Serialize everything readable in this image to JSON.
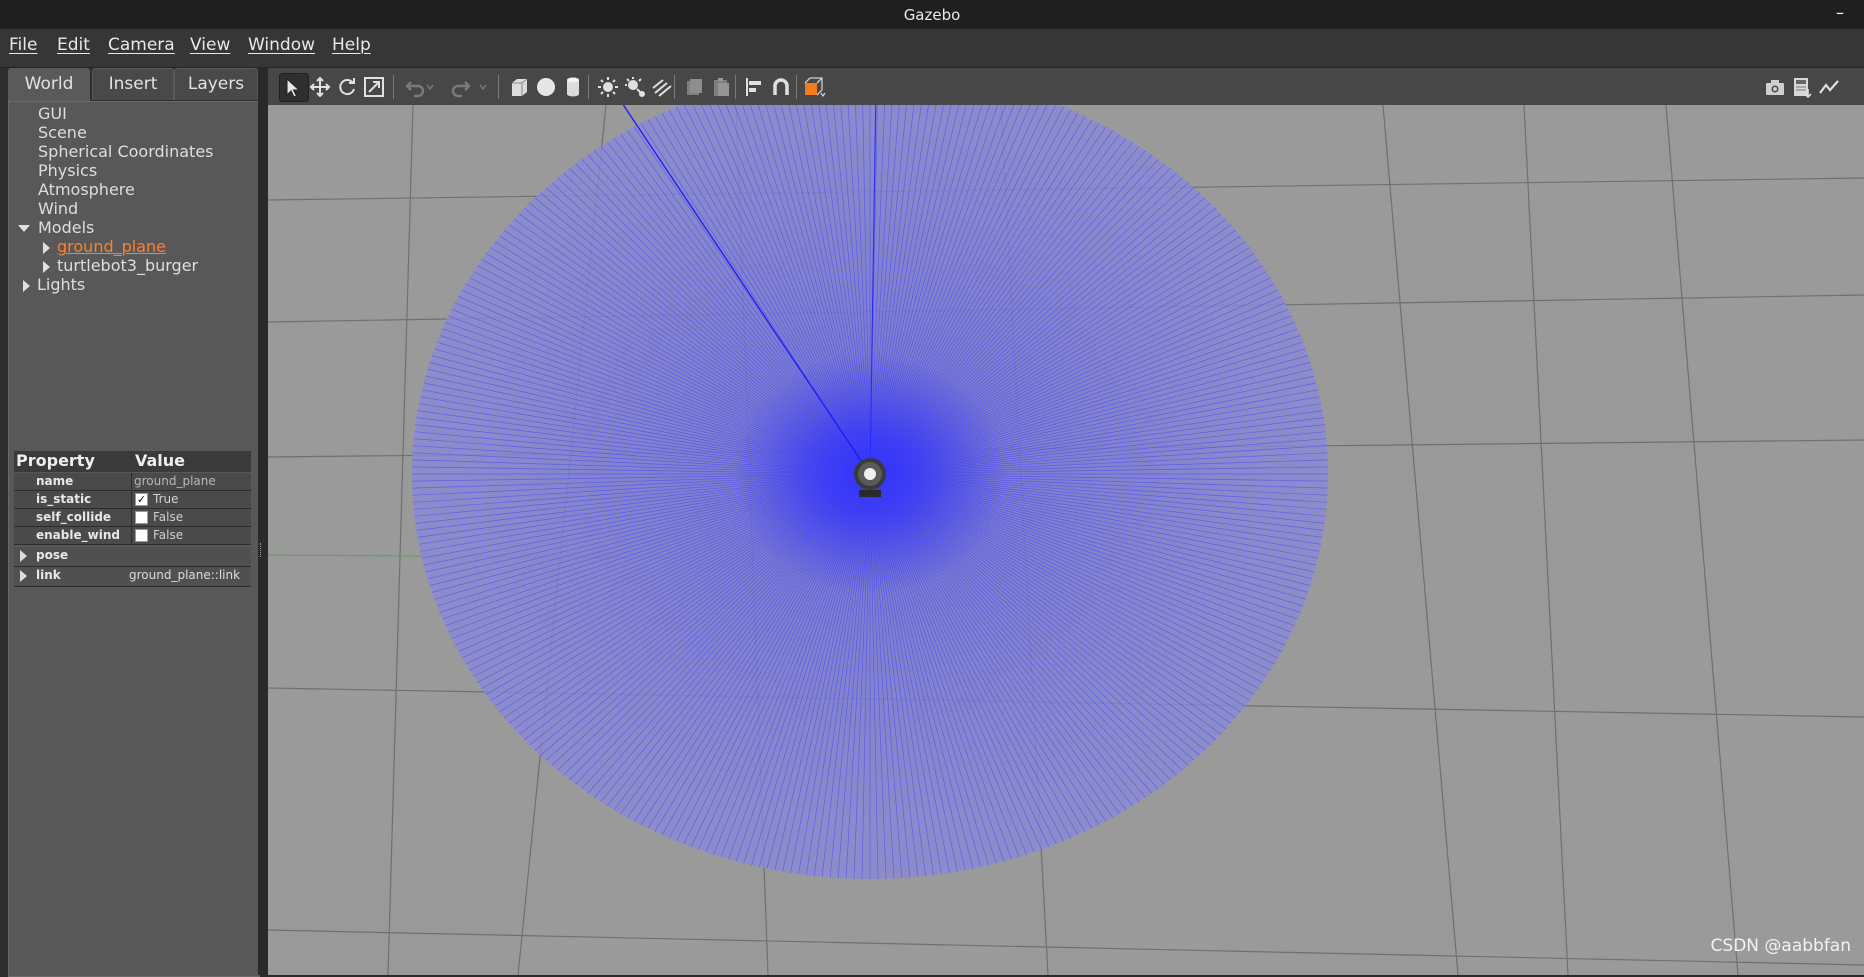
{
  "window": {
    "title": "Gazebo",
    "minimize_symbol": "–"
  },
  "menu": [
    "File",
    "Edit",
    "Camera",
    "View",
    "Window",
    "Help"
  ],
  "tabs": [
    "World",
    "Insert",
    "Layers"
  ],
  "tree": {
    "items": [
      "GUI",
      "Scene",
      "Spherical Coordinates",
      "Physics",
      "Atmosphere",
      "Wind"
    ],
    "models_label": "Models",
    "models": [
      "ground_plane",
      "turtlebot3_burger"
    ],
    "lights_label": "Lights"
  },
  "properties": {
    "header_property": "Property",
    "header_value": "Value",
    "name_key": "name",
    "name_value": "ground_plane",
    "is_static_key": "is_static",
    "is_static_value": "True",
    "is_static_checked": true,
    "self_collide_key": "self_collide",
    "self_collide_value": "False",
    "self_collide_checked": false,
    "enable_wind_key": "enable_wind",
    "enable_wind_value": "False",
    "enable_wind_checked": false,
    "pose_key": "pose",
    "link_key": "link",
    "link_value": "ground_plane::link"
  },
  "toolbar": {
    "selected_tool": "select",
    "icons": [
      "select-arrow-icon",
      "translate-icon",
      "rotate-icon",
      "scale-icon",
      "undo-icon",
      "undo-dropdown-icon",
      "redo-icon",
      "redo-dropdown-icon",
      "box-icon",
      "sphere-icon",
      "cylinder-icon",
      "point-light-icon",
      "spot-light-icon",
      "directional-light-icon",
      "copy-icon",
      "paste-icon",
      "align-icon",
      "snap-icon",
      "view-angle-icon",
      "screenshot-icon",
      "log-icon",
      "plot-icon"
    ]
  },
  "viewport": {
    "lidar_color": "#3a3aff",
    "ground_color": "#9a9a9a",
    "grid_color": "#6e6e6e"
  },
  "watermark": "CSDN @aabbfan"
}
